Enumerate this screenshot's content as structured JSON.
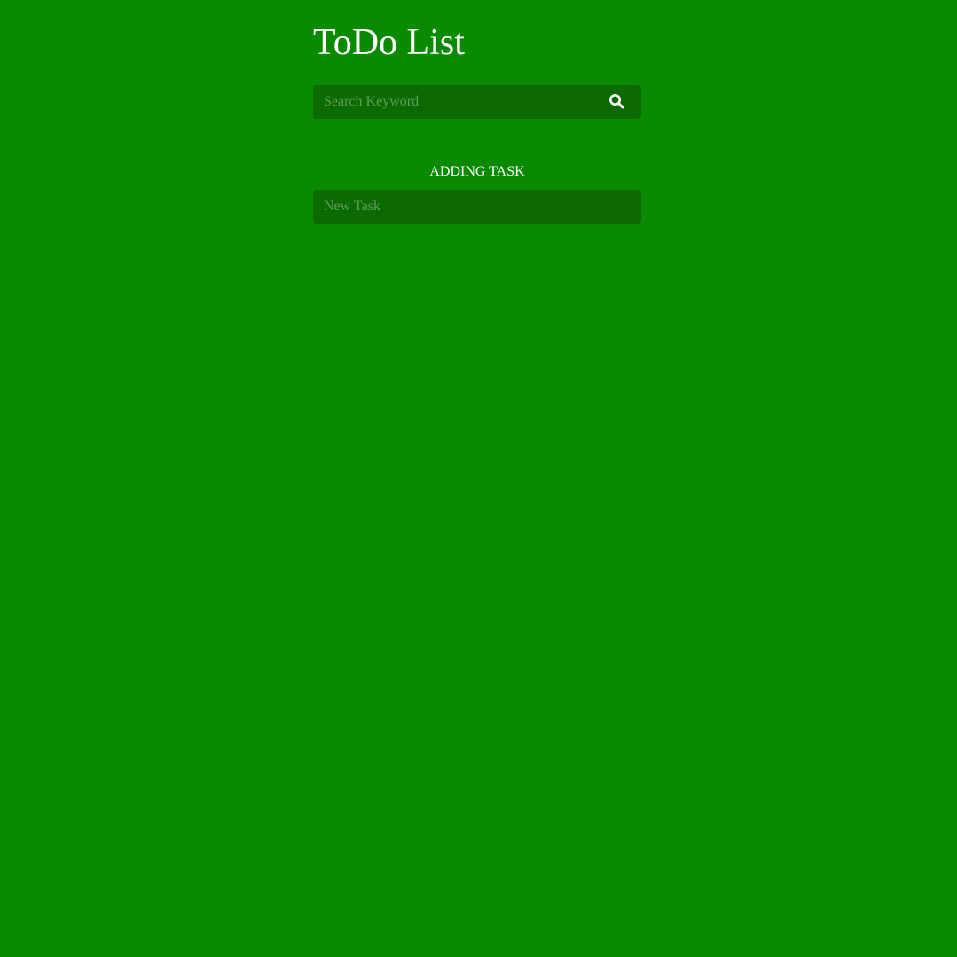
{
  "header": {
    "title": "ToDo List"
  },
  "search": {
    "placeholder": "Search Keyword",
    "value": "",
    "icon": "search-icon"
  },
  "add_task": {
    "heading": "ADDING TASK",
    "placeholder": "New Task",
    "value": ""
  },
  "colors": {
    "background": "#0a8a00",
    "input_background": "#0b6b02",
    "text": "#ffffff"
  }
}
